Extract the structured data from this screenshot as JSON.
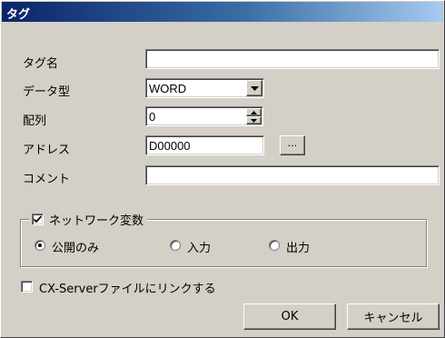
{
  "window": {
    "title": "タグ"
  },
  "form": {
    "tag_name": {
      "label": "タグ名",
      "value": ""
    },
    "data_type": {
      "label": "データ型",
      "value": "WORD"
    },
    "array": {
      "label": "配列",
      "value": "0"
    },
    "address": {
      "label": "アドレス",
      "value": "D00000",
      "browse_label": "..."
    },
    "comment": {
      "label": "コメント",
      "value": ""
    }
  },
  "network_group": {
    "title": "ネットワーク変数",
    "checked": true,
    "options": [
      {
        "label": "公開のみ",
        "selected": true
      },
      {
        "label": "入力",
        "selected": false
      },
      {
        "label": "出力",
        "selected": false
      }
    ]
  },
  "cx_server_link": {
    "label": "CX-Serverファイルにリンクする",
    "checked": false
  },
  "buttons": {
    "ok": "OK",
    "cancel": "キャンセル"
  },
  "icons": {
    "dropdown": "chevron-down-icon",
    "spin": "spin-arrows-icon",
    "check": "checkmark-icon"
  }
}
